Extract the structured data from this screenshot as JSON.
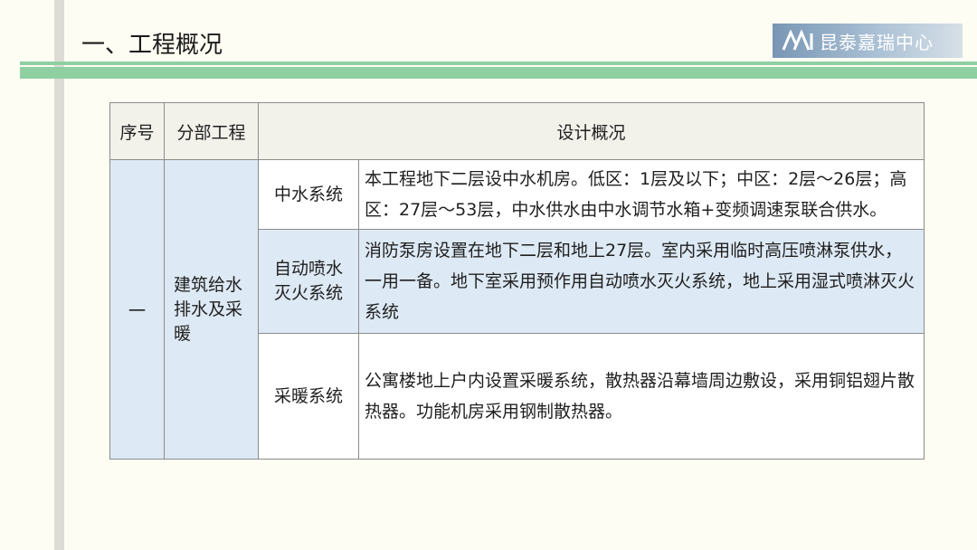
{
  "slide": {
    "title": "一、工程概况",
    "logo_text": "昆泰嘉瑞中心"
  },
  "table": {
    "headers": [
      "序号",
      "分部工程",
      "设计概况"
    ],
    "index": "一",
    "category": [
      "建筑给水",
      "排水及采",
      "暖"
    ],
    "rows": [
      {
        "system": [
          "中水系统"
        ],
        "description": "本工程地下二层设中水机房。低区：1层及以下；中区：2层～26层；高区：27层～53层，中水供水由中水调节水箱+变频调速泵联合供水。"
      },
      {
        "system": [
          "自动喷水",
          "灭火系统"
        ],
        "description": "消防泵房设置在地下二层和地上27层。室内采用临时高压喷淋泵供水，一用一备。地下室采用预作用自动喷水灭火系统，地上采用湿式喷淋灭火系统"
      },
      {
        "system": [
          "采暖系统"
        ],
        "description": "公寓楼地上户内设置采暖系统，散热器沿幕墙周边敷设，采用铜铝翅片散热器。功能机房采用钢制散热器。"
      }
    ]
  },
  "colors": {
    "accent_band": "#8fd0a3",
    "cell_blue": "#dde9f4",
    "header_bg": "#f2f1ea",
    "page_bg": "#fefdf3"
  }
}
